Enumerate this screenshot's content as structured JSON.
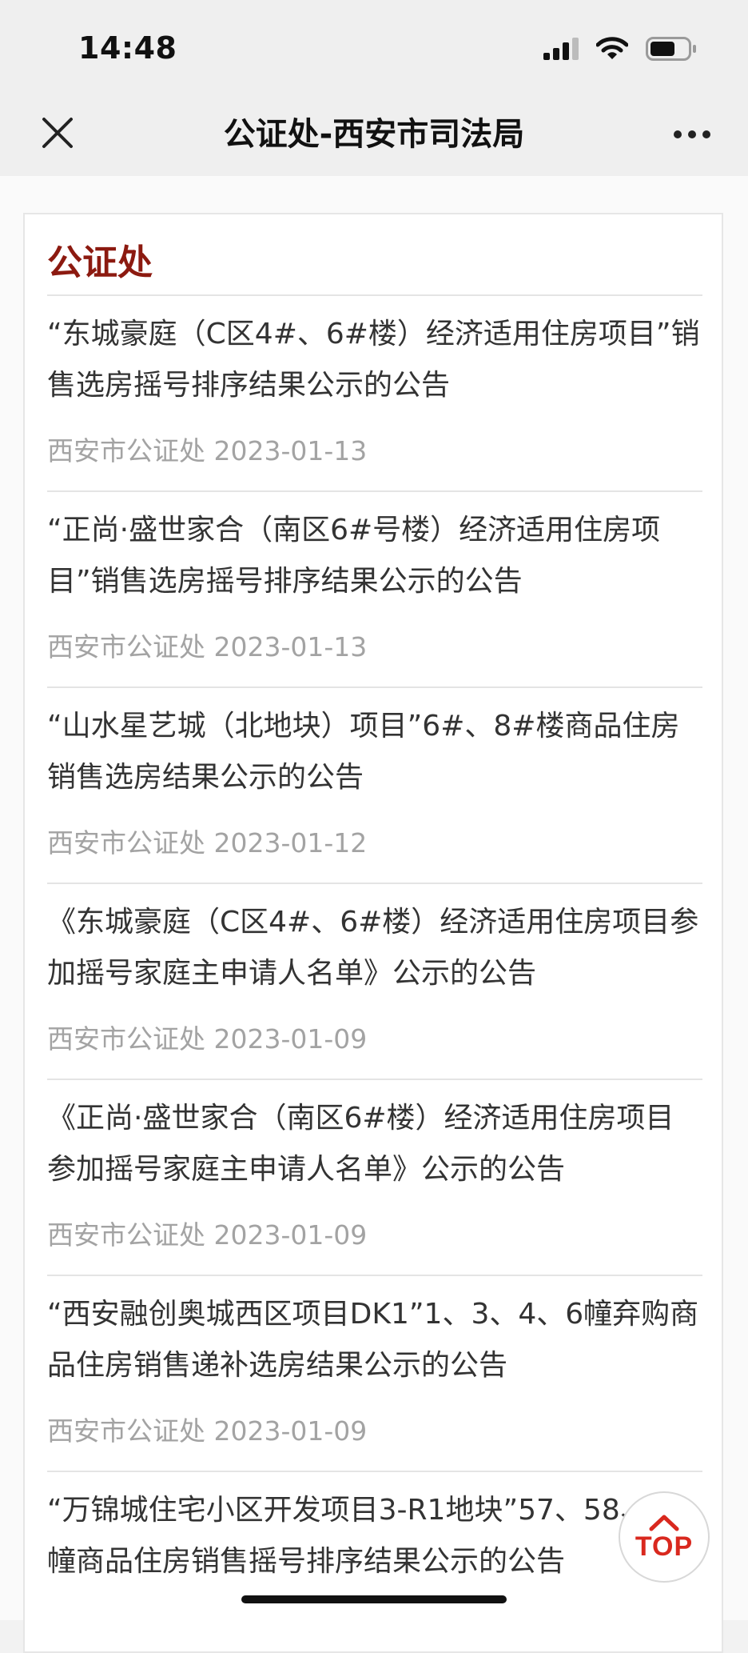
{
  "status_bar": {
    "time": "14:48",
    "icons": [
      "signal-icon",
      "wifi-icon",
      "battery-icon"
    ]
  },
  "nav": {
    "title": "公证处-西安市司法局",
    "close_icon": "close-icon",
    "more_icon": "more-dots-icon"
  },
  "section": {
    "title": "公证处",
    "accent_color": "#8c1a10"
  },
  "items": [
    {
      "title": "“东城豪庭（C区4#、6#楼）经济适用住房项目”销售选房摇号排序结果公示的公告",
      "meta": "西安市公证处 2023-01-13"
    },
    {
      "title": "“正尚·盛世家合（南区6#号楼）经济适用住房项目”销售选房摇号排序结果公示的公告",
      "meta": "西安市公证处 2023-01-13"
    },
    {
      "title": "“山水星艺城（北地块）项目”6#、8#楼商品住房销售选房结果公示的公告",
      "meta": "西安市公证处 2023-01-12"
    },
    {
      "title": "《东城豪庭（C区4#、6#楼）经济适用住房项目参加摇号家庭主申请人名单》公示的公告",
      "meta": "西安市公证处 2023-01-09"
    },
    {
      "title": "《正尚·盛世家合（南区6#楼）经济适用住房项目参加摇号家庭主申请人名单》公示的公告",
      "meta": "西安市公证处 2023-01-09"
    },
    {
      "title": "“西安融创奥城西区项目DK1”1、3、4、6幢弃购商品住房销售递补选房结果公示的公告",
      "meta": "西安市公证处 2023-01-09"
    },
    {
      "title": "“万锦城住宅小区开发项目3-R1地块”57、58、71幢商品住房销售摇号排序结果公示的公告",
      "meta": ""
    }
  ],
  "top_button": {
    "label": "TOP",
    "icon": "chevron-up-icon",
    "color": "#d9281e"
  }
}
